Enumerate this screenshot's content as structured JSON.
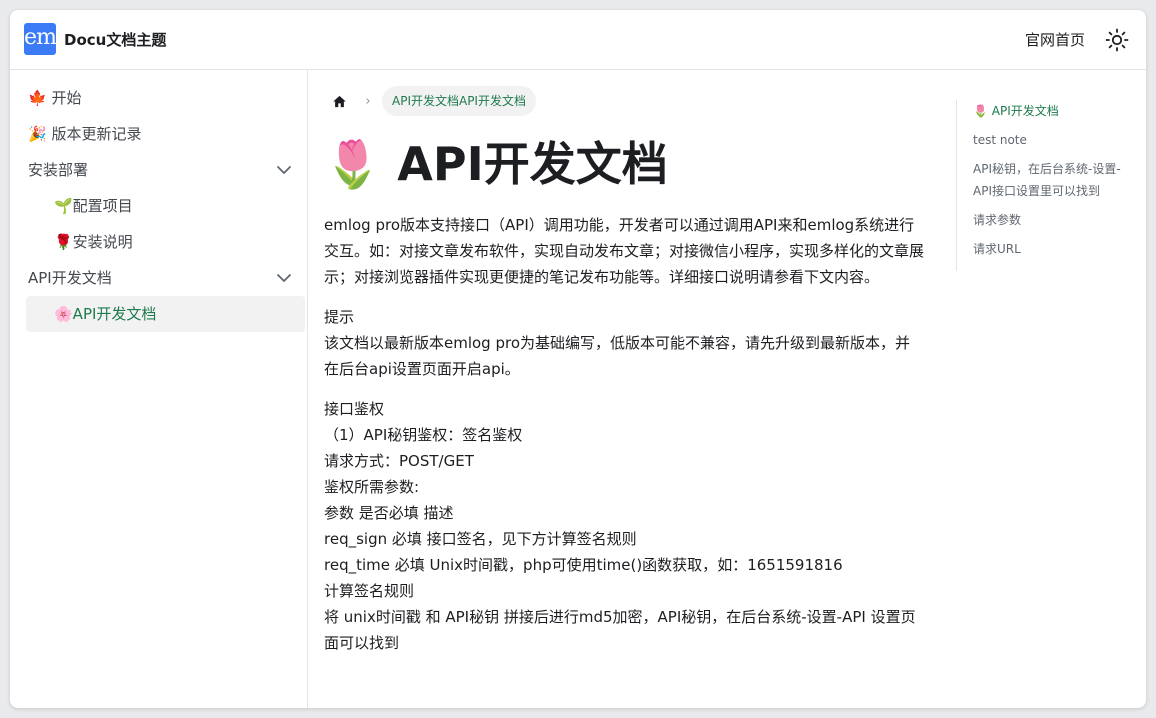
{
  "header": {
    "logo_text": "em",
    "brand": "Docu文档主题",
    "nav_home": "官网首页",
    "theme_icon": "sun-icon"
  },
  "sidebar": {
    "items": [
      {
        "label": "🍁 开始"
      },
      {
        "label": "🎉 版本更新记录"
      },
      {
        "label": "安装部署"
      },
      {
        "label": "🌱配置项目"
      },
      {
        "label": "🌹安装说明"
      },
      {
        "label": "API开发文档"
      },
      {
        "label": "🌸API开发文档"
      }
    ],
    "active_color": "#1f7a4d"
  },
  "breadcrumb": {
    "home_icon": "home-icon",
    "separator": "›",
    "current": "API开发文档API开发文档"
  },
  "page": {
    "title": "🌷 API开发文档",
    "paragraphs": [
      "emlog pro版本支持接口（API）调用功能，开发者可以通过调用API来和emlog系统进行交互。如：对接文章发布软件，实现自动发布文章；对接微信小程序，实现多样化的文章展示；对接浏览器插件实现更便捷的笔记发布功能等。详细接口说明请参看下文内容。"
    ],
    "note_title": "提示",
    "note_text": "该文档以最新版本emlog pro为基础编写，低版本可能不兼容，请先升级到最新版本，并在后台api设置页面开启api。",
    "lines": [
      "接口鉴权",
      "（1）API秘钥鉴权：签名鉴权",
      "请求方式：POST/GET",
      "鉴权所需参数:",
      "参数 是否必填 描述",
      "req_sign 必填 接口签名，见下方计算签名规则",
      "req_time 必填 Unix时间戳，php可使用time()函数获取，如：1651591816",
      "计算签名规则",
      "将 unix时间戳 和 API秘钥 拼接后进行md5加密，API秘钥，在后台系统-设置-API 设置页面可以找到"
    ]
  },
  "toc": {
    "items": [
      {
        "label": "🌷 API开发文档"
      },
      {
        "label": "test note"
      },
      {
        "label": "API秘钥，在后台系统-设置-API接口设置里可以找到"
      },
      {
        "label": "请求参数"
      },
      {
        "label": "请求URL"
      }
    ]
  }
}
